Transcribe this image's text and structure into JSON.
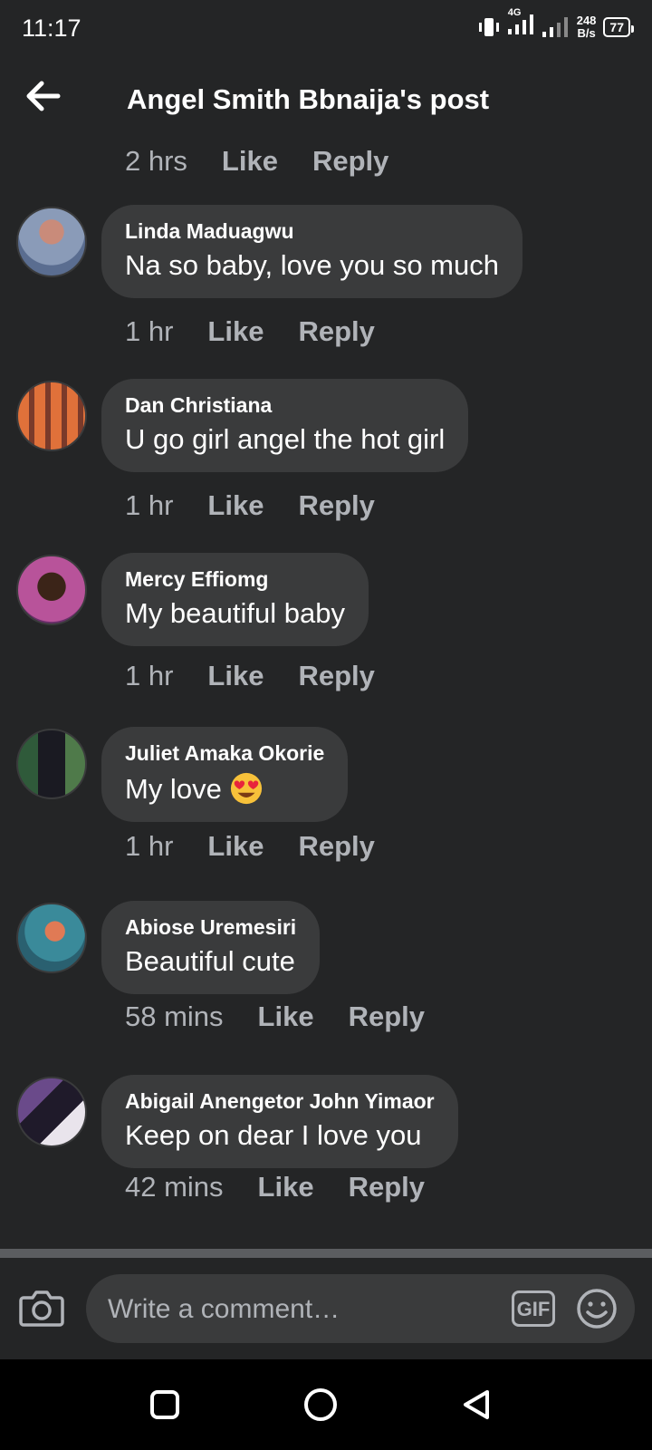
{
  "status": {
    "time": "11:17",
    "network": "4G",
    "speed_value": "248",
    "speed_unit": "B/s",
    "battery": "77"
  },
  "header": {
    "title": "Angel Smith Bbnaija's post"
  },
  "top_meta": {
    "time": "2 hrs",
    "like": "Like",
    "reply": "Reply"
  },
  "comments": [
    {
      "author": "Linda Maduagwu",
      "text": "Na so baby, love you so much",
      "time": "1 hr",
      "like": "Like",
      "reply": "Reply"
    },
    {
      "author": "Dan Christiana",
      "text": "U go girl angel the hot girl",
      "time": "1 hr",
      "like": "Like",
      "reply": "Reply"
    },
    {
      "author": "Mercy Effiomg",
      "text": "My beautiful baby",
      "time": "1 hr",
      "like": "Like",
      "reply": "Reply"
    },
    {
      "author": "Juliet Amaka Okorie",
      "text": "My love",
      "emoji": "heart-eyes-emoji",
      "time": "1 hr",
      "like": "Like",
      "reply": "Reply"
    },
    {
      "author": "Abiose Uremesiri",
      "text": "Beautiful cute",
      "time": "58 mins",
      "like": "Like",
      "reply": "Reply"
    },
    {
      "author": "Abigail Anengetor John Yimaor",
      "text": "Keep on dear I love you",
      "time": "42 mins",
      "like": "Like",
      "reply": "Reply"
    }
  ],
  "composer": {
    "placeholder": "Write a comment…",
    "gif_label": "GIF"
  },
  "colors": {
    "background": "#242526",
    "bubble": "#3a3b3c",
    "secondary_text": "#b0b3b8"
  }
}
